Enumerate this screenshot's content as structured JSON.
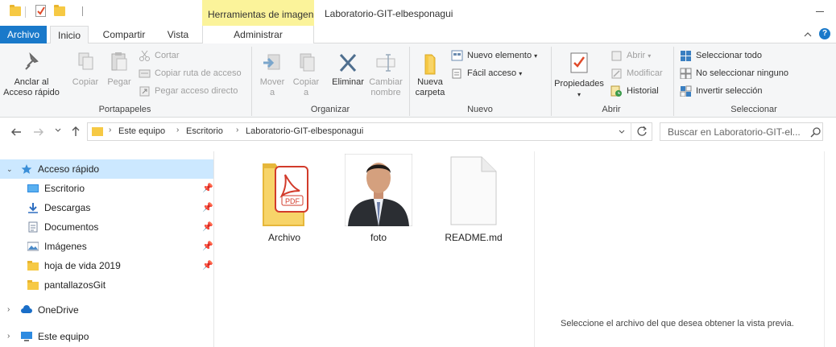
{
  "window": {
    "title": "Laboratorio-GIT-elbesponagui",
    "contextual_tab_title": "Herramientas de imagen"
  },
  "tabs": {
    "archivo": "Archivo",
    "inicio": "Inicio",
    "compartir": "Compartir",
    "vista": "Vista",
    "administrar": "Administrar"
  },
  "help_label": "?",
  "ribbon": {
    "portapapeles": {
      "label": "Portapapeles",
      "pin_quick_access": "Anclar al\nAcceso rápido",
      "pin_line1": "Anclar al",
      "pin_line2": "Acceso rápido",
      "copy": "Copiar",
      "paste": "Pegar",
      "cut": "Cortar",
      "copy_path": "Copiar ruta de acceso",
      "paste_shortcut": "Pegar acceso directo"
    },
    "organizar": {
      "label": "Organizar",
      "move_line1": "Mover",
      "move_line2": "a",
      "copy_line1": "Copiar",
      "copy_line2": "a",
      "delete": "Eliminar",
      "rename_line1": "Cambiar",
      "rename_line2": "nombre"
    },
    "nuevo": {
      "label": "Nuevo",
      "new_folder_line1": "Nueva",
      "new_folder_line2": "carpeta",
      "new_item": "Nuevo elemento",
      "easy_access": "Fácil acceso"
    },
    "abrir": {
      "label": "Abrir",
      "properties": "Propiedades",
      "open": "Abrir",
      "modify": "Modificar",
      "history": "Historial"
    },
    "seleccionar": {
      "label": "Seleccionar",
      "select_all": "Seleccionar todo",
      "select_none": "No seleccionar ninguno",
      "invert": "Invertir selección"
    }
  },
  "address": {
    "crumbs": [
      "Este equipo",
      "Escritorio",
      "Laboratorio-GIT-elbesponagui"
    ],
    "search_placeholder": "Buscar en Laboratorio-GIT-el..."
  },
  "nav": {
    "quick_access": "Acceso rápido",
    "items": [
      {
        "label": "Escritorio",
        "icon": "desktop-icon"
      },
      {
        "label": "Descargas",
        "icon": "download-icon"
      },
      {
        "label": "Documentos",
        "icon": "documents-icon"
      },
      {
        "label": "Imágenes",
        "icon": "pictures-icon"
      },
      {
        "label": "hoja de vida 2019",
        "icon": "folder-icon"
      },
      {
        "label": "pantallazosGit",
        "icon": "folder-icon"
      }
    ],
    "onedrive": "OneDrive",
    "this_pc": "Este equipo"
  },
  "files": [
    {
      "name": "Archivo",
      "type": "folder-pdf"
    },
    {
      "name": "foto",
      "type": "image"
    },
    {
      "name": "README.md",
      "type": "document"
    }
  ],
  "preview_message": "Seleccione el archivo del que desea obtener la vista previa.",
  "colors": {
    "accent": "#1979ca",
    "contextual_tab": "#fbf39a",
    "selection": "#cce8ff",
    "folder": "#f6c944"
  }
}
